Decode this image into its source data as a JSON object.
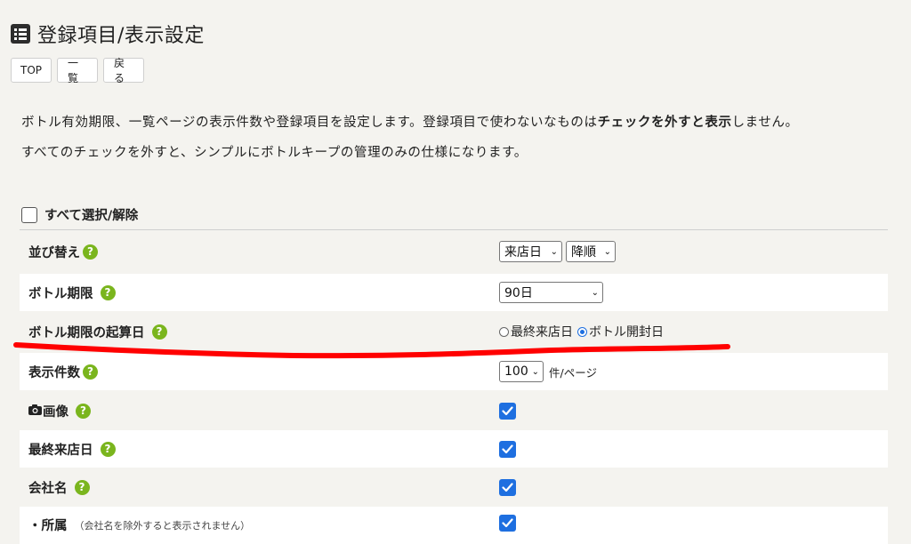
{
  "header": {
    "title": "登録項目/表示設定",
    "icon": "list-icon"
  },
  "nav": {
    "top": "TOP",
    "list": "一覧",
    "back": "戻る"
  },
  "description": {
    "line1_pre": "ボトル有効期限、一覧ページの表示件数や登録項目を設定します。登録項目で使わないなものは",
    "line1_bold": "チェックを外すと表示",
    "line1_post": "しません。",
    "line2": "すべてのチェックを外すと、シンプルにボトルキープの管理のみの仕様になります。"
  },
  "select_all": {
    "label": "すべて選択/解除",
    "checked": false
  },
  "rows": {
    "sort": {
      "label": "並び替え",
      "help": "?",
      "field": "来店日",
      "order": "降順"
    },
    "bottle_period": {
      "label": "ボトル期限",
      "help": "?",
      "value": "90日"
    },
    "start_date": {
      "label": "ボトル期限の起算日",
      "help": "?",
      "option1": "最終来店日",
      "option2": "ボトル開封日",
      "selected": "ボトル開封日"
    },
    "display_count": {
      "label": "表示件数",
      "help": "?",
      "value": "100",
      "unit": "件/ページ"
    },
    "image": {
      "label": "画像",
      "help": "?",
      "checked": true
    },
    "last_visit": {
      "label": "最終来店日",
      "help": "?",
      "checked": true
    },
    "company": {
      "label": "会社名",
      "help": "?",
      "checked": true
    },
    "affiliation": {
      "label": "・所属",
      "note": "（会社名を除外すると表示されません）",
      "checked": true
    }
  },
  "colors": {
    "accent_blue": "#1e6fe0",
    "help_green": "#7ab51d",
    "annotation_red": "#ff0000"
  }
}
